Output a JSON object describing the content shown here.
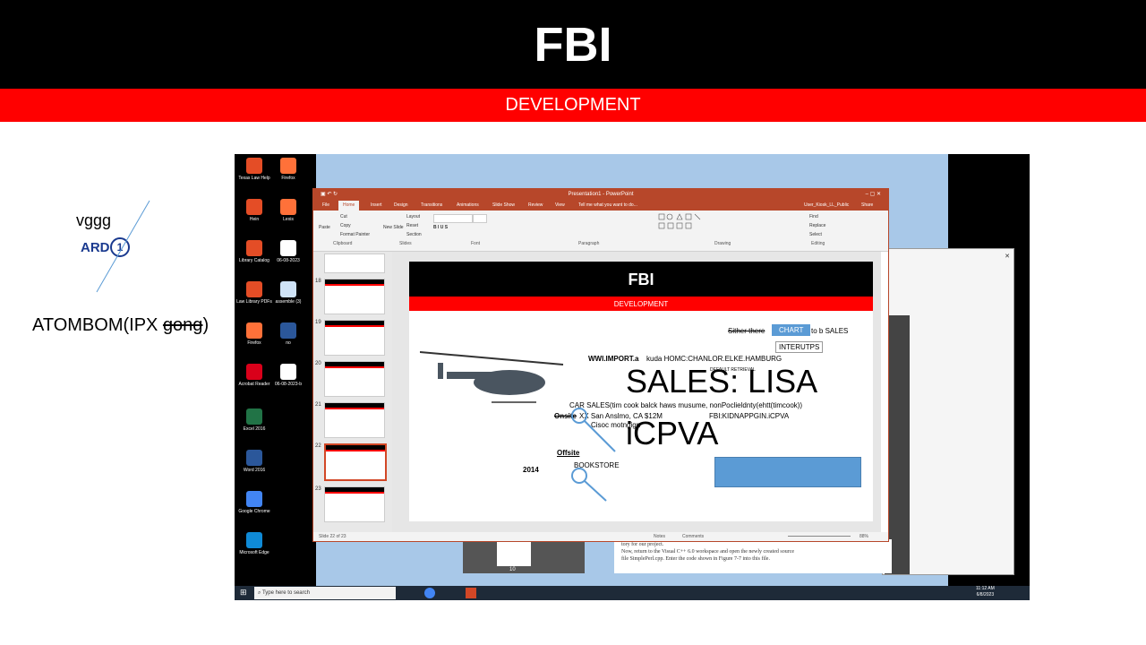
{
  "header": {
    "title": "FBI",
    "subtitle": "DEVELOPMENT"
  },
  "annotations": {
    "vggg": "vggg",
    "ard": "ARD",
    "ard_badge": "1",
    "atombom_pre": "ATOMBOM(IPX ",
    "atombom_strike": "gong",
    "atombom_post": ")"
  },
  "desktop": {
    "icons": [
      {
        "label": "Texas Law Help",
        "color": "#e44d26"
      },
      {
        "label": "Firefox",
        "color": "#ff7139"
      },
      {
        "label": "Hein",
        "color": "#e44d26"
      },
      {
        "label": "Lexis",
        "color": "#ff7139"
      },
      {
        "label": "Library Catalog",
        "color": "#e44d26"
      },
      {
        "label": "06-08-2023",
        "color": "#ffffff"
      },
      {
        "label": "Law Library PDFs",
        "color": "#e44d26"
      },
      {
        "label": "assemble (3)",
        "color": "#cfe3f7"
      },
      {
        "label": "Firefox",
        "color": "#ff7139"
      },
      {
        "label": "no",
        "color": "#2b579a"
      },
      {
        "label": "Acrobat Reader",
        "color": "#d9001a"
      },
      {
        "label": "06-08-2023-b",
        "color": "#ffffff"
      },
      {
        "label": "Excel 2016",
        "color": "#217346"
      },
      {
        "label": "Word 2016",
        "color": "#2b579a"
      },
      {
        "label": "Google Chrome",
        "color": "#4285f4"
      },
      {
        "label": "Microsoft Edge",
        "color": "#0f8ad6"
      }
    ],
    "taskbar": {
      "search_placeholder": "Type here to search",
      "time": "11:12 AM",
      "date": "6/8/2023"
    }
  },
  "powerpoint": {
    "window_title": "Presentation1 - PowerPoint",
    "user": "User_Kiosk_LL_Public",
    "share": "Share",
    "tabs": [
      "File",
      "Home",
      "Insert",
      "Design",
      "Transitions",
      "Animations",
      "Slide Show",
      "Review",
      "View",
      "Tell me what you want to do..."
    ],
    "ribbon_groups": [
      "Clipboard",
      "Slides",
      "Font",
      "Paragraph",
      "Drawing",
      "Editing"
    ],
    "clipboard": {
      "paste": "Paste",
      "cut": "Cut",
      "copy": "Copy",
      "format_painter": "Format Painter"
    },
    "slides_group": {
      "new_slide": "New Slide",
      "layout": "Layout",
      "reset": "Reset",
      "section": "Section"
    },
    "editing": {
      "find": "Find",
      "replace": "Replace",
      "select": "Select"
    },
    "thumb_numbers": [
      "18",
      "19",
      "20",
      "21",
      "22",
      "23"
    ],
    "status": {
      "slide_info": "Slide 22 of 23",
      "notes": "Notes",
      "comments": "Comments",
      "zoom": "88%"
    },
    "slide": {
      "title": "FBI",
      "subtitle": "DEVELOPMENT",
      "sither": "Sither there",
      "chart": "CHART",
      "to_sales": "to b SALES",
      "interutps": "INTERUTPS",
      "www": "WWI.IMPORT.a",
      "kuda": "kuda HOMC:CHANLOR.ELKE.HAMBURG",
      "default_retrieval": "DEFAULT RETRIEVAL",
      "sales_lisa": "SALES: LISA",
      "car_sales": "CAR SALES(tim cook balck haws musume, nonPoclieldnty(ehtt(timcook))",
      "onsite": "Onsite",
      "ca": "XX San Anslmo, CA $12M",
      "kidnap": "FBI:KIDNAPPGIN.iCPVA",
      "cisoc": "Cisoc motngign",
      "icpva": "iCPVA",
      "offsite": "Offsite",
      "year": "2014",
      "bookstore": "BOOKSTORE"
    }
  },
  "pdf_viewer": {
    "page_number": "10",
    "text1": "tory for our project.",
    "text2": "Now, return to the Visual C++ 6.0 workspace and open the newly created source",
    "text3": "file SimplePerl.cpp. Enter the code shown in Figure 7-7 into this file."
  }
}
